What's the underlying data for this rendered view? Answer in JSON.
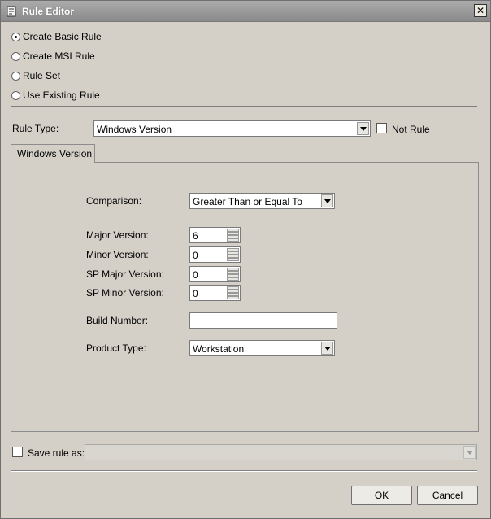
{
  "window": {
    "title": "Rule Editor",
    "close_glyph": "✕"
  },
  "rule_kind": {
    "options": [
      {
        "label": "Create Basic Rule",
        "checked": true
      },
      {
        "label": "Create MSI Rule",
        "checked": false
      },
      {
        "label": "Rule Set",
        "checked": false
      },
      {
        "label": "Use Existing Rule",
        "checked": false
      }
    ]
  },
  "rule_type": {
    "label": "Rule Type:",
    "value": "Windows Version",
    "not_rule_label": "Not Rule"
  },
  "tab": {
    "label": "Windows Version"
  },
  "form": {
    "comparison_label": "Comparison:",
    "comparison_value": "Greater Than or Equal To",
    "major_label": "Major Version:",
    "major_value": "6",
    "minor_label": "Minor Version:",
    "minor_value": "0",
    "sp_major_label": "SP Major Version:",
    "sp_major_value": "0",
    "sp_minor_label": "SP Minor Version:",
    "sp_minor_value": "0",
    "build_label": "Build Number:",
    "build_value": "",
    "product_label": "Product Type:",
    "product_value": "Workstation"
  },
  "save": {
    "label": "Save rule as:",
    "value": ""
  },
  "buttons": {
    "ok": "OK",
    "cancel": "Cancel"
  }
}
